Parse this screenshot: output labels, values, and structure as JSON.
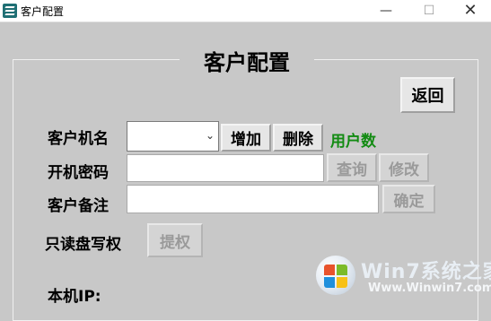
{
  "window": {
    "title": "客户配置",
    "minimize": "—",
    "maximize": "☐",
    "close": "✕"
  },
  "form": {
    "heading": "客户配置",
    "back_button": "返回",
    "client_name_label": "客户机名",
    "client_name_value": "",
    "add_button": "增加",
    "delete_button": "删除",
    "user_count_label": "用户数",
    "boot_password_label": "开机密码",
    "boot_password_value": "",
    "query_button": "查询",
    "modify_button": "修改",
    "client_note_label": "客户备注",
    "client_note_value": "",
    "confirm_button": "确定",
    "readonly_label": "只读盘写权",
    "grant_button": "提权",
    "local_ip_label": "本机IP:"
  },
  "watermark": {
    "brand": "Win7系统之家",
    "url": "Www.Winwin7.com"
  }
}
